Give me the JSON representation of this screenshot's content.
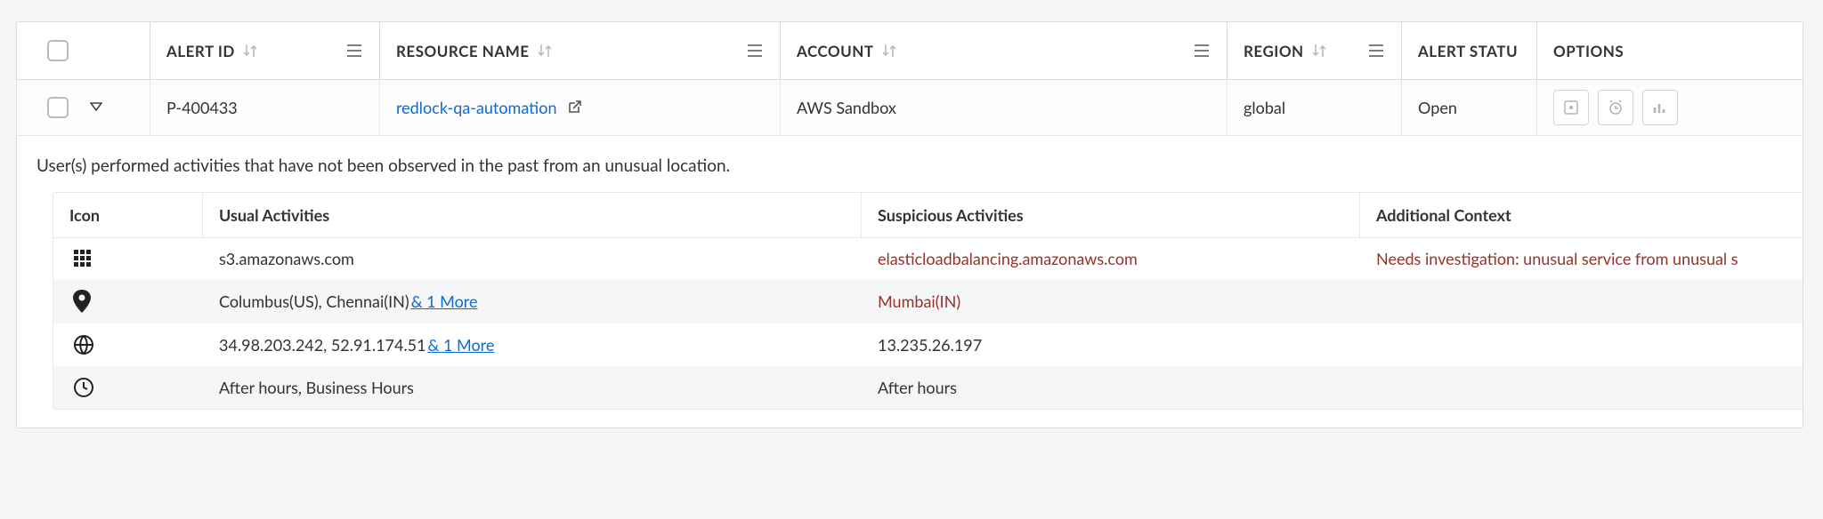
{
  "columns": {
    "alert_id": "ALERT ID",
    "resource_name": "RESOURCE NAME",
    "account": "ACCOUNT",
    "region": "REGION",
    "alert_status": "ALERT STATU",
    "options": "OPTIONS"
  },
  "row": {
    "alert_id": "P-400433",
    "resource_name": "redlock-qa-automation",
    "account": "AWS Sandbox",
    "region": "global",
    "status": "Open"
  },
  "detail": {
    "message": "User(s) performed activities that have not been observed in the past from an unusual location.",
    "headers": {
      "icon": "Icon",
      "usual": "Usual Activities",
      "suspicious": "Suspicious Activities",
      "context": "Additional Context"
    },
    "rows": {
      "service": {
        "usual": "s3.amazonaws.com",
        "suspicious": "elasticloadbalancing.amazonaws.com",
        "context": "Needs investigation: unusual service from unusual s"
      },
      "location": {
        "usual": "Columbus(US), Chennai(IN) ",
        "usual_more": "& 1 More",
        "suspicious": "Mumbai(IN)",
        "context": ""
      },
      "ip": {
        "usual": "34.98.203.242, 52.91.174.51 ",
        "usual_more": "& 1 More",
        "suspicious": "13.235.26.197",
        "context": ""
      },
      "time": {
        "usual": "After hours, Business Hours",
        "suspicious": "After hours",
        "context": ""
      }
    }
  }
}
